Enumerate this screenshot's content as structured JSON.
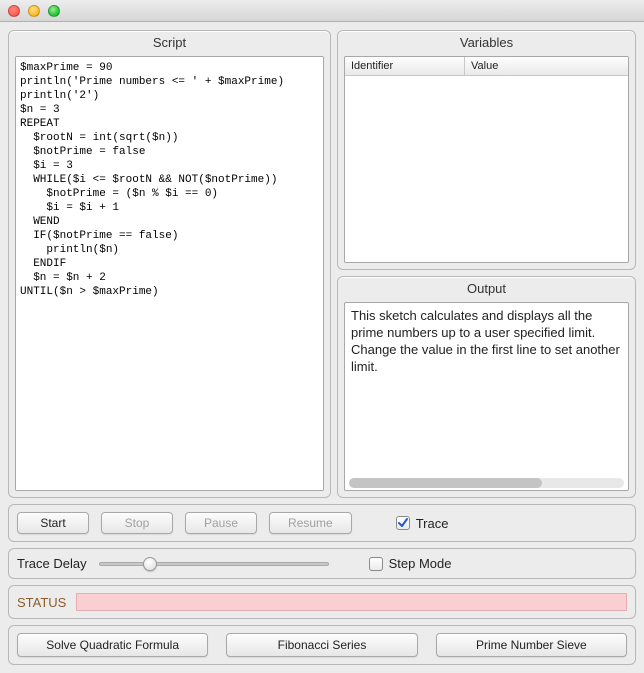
{
  "window": {
    "title": ""
  },
  "panels": {
    "script_title": "Script",
    "variables_title": "Variables",
    "output_title": "Output"
  },
  "script": "$maxPrime = 90\nprintln('Prime numbers <= ' + $maxPrime)\nprintln('2')\n$n = 3\nREPEAT\n  $rootN = int(sqrt($n))\n  $notPrime = false\n  $i = 3\n  WHILE($i <= $rootN && NOT($notPrime))\n    $notPrime = ($n % $i == 0)\n    $i = $i + 1\n  WEND\n  IF($notPrime == false)\n    println($n)\n  ENDIF\n  $n = $n + 2\nUNTIL($n > $maxPrime)",
  "variables": {
    "col_identifier": "Identifier",
    "col_value": "Value",
    "rows": []
  },
  "output": "This sketch calculates and displays all the prime numbers up to a user specified limit. Change the value in the first line to set another limit.",
  "controls": {
    "start": "Start",
    "stop": "Stop",
    "pause": "Pause",
    "resume": "Resume",
    "trace_label": "Trace",
    "trace_checked": true
  },
  "trace": {
    "delay_label": "Trace Delay",
    "slider_value": 22,
    "step_mode_label": "Step Mode",
    "step_mode_checked": false
  },
  "status": {
    "label": "STATUS",
    "text": ""
  },
  "examples": {
    "quadratic": "Solve Quadratic Formula",
    "fibonacci": "Fibonacci Series",
    "sieve": "Prime Number Sieve"
  },
  "colors": {
    "status_bg": "#f9cfd1",
    "status_label": "#8a5c2e"
  }
}
